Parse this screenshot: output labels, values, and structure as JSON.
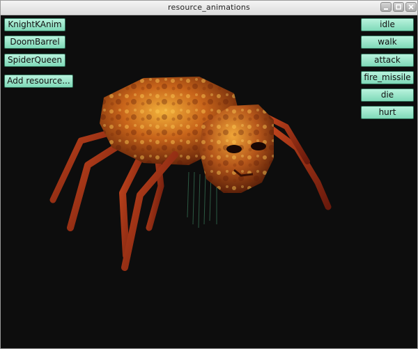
{
  "window": {
    "title": "resource_animations"
  },
  "resources": {
    "items": [
      {
        "label": "KnightKAnim"
      },
      {
        "label": "DoomBarrel"
      },
      {
        "label": "SpiderQueen"
      }
    ],
    "add_label": "Add resource..."
  },
  "animations": {
    "items": [
      {
        "label": "idle"
      },
      {
        "label": "walk"
      },
      {
        "label": "attack"
      },
      {
        "label": "fire_missile"
      },
      {
        "label": "die"
      },
      {
        "label": "hurt"
      }
    ]
  },
  "colors": {
    "button_bg": "#9be6c9",
    "viewport_bg": "#0d0d0d",
    "spider_body": "#c8641a"
  }
}
